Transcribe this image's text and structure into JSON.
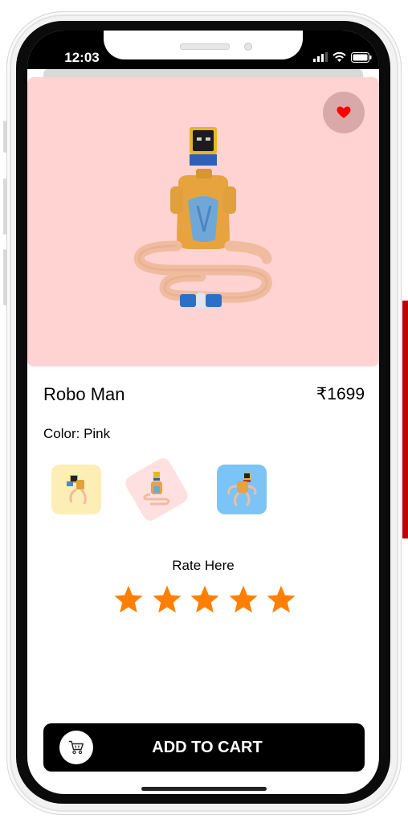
{
  "status_bar": {
    "time": "12:03"
  },
  "product": {
    "name": "Robo Man",
    "price": "₹1699",
    "color_label": "Color: Pink",
    "hero_background": "#ffd3d2",
    "favorite_icon": "heart-icon",
    "favorite_color": "#ff0000"
  },
  "color_options": [
    {
      "name": "Yellow",
      "color": "#fdeeb5"
    },
    {
      "name": "Pink",
      "color": "#ffe0e0",
      "selected": true
    },
    {
      "name": "Blue",
      "color": "#7cc4f5"
    }
  ],
  "rating": {
    "label": "Rate Here",
    "stars": 5,
    "star_color": "#ff8000"
  },
  "cart_button": {
    "label": "ADD TO CART",
    "icon": "cart-icon"
  }
}
